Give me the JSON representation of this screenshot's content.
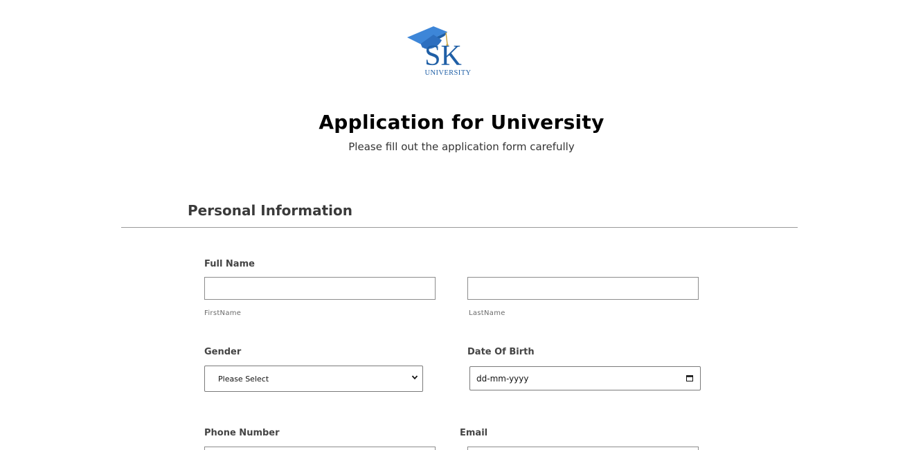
{
  "logo": {
    "mark": "SK",
    "subtext": "UNIVERSITY",
    "icon": "graduation-cap-icon"
  },
  "header": {
    "title": "Application for University",
    "subtitle": "Please fill out the application form carefully"
  },
  "section": {
    "title": "Personal Information"
  },
  "form": {
    "full_name": {
      "label": "Full Name",
      "first_value": "",
      "first_sublabel": "FirstName",
      "last_value": "",
      "last_sublabel": "LastName"
    },
    "gender": {
      "label": "Gender",
      "selected": "Please Select"
    },
    "dob": {
      "label": "Date Of Birth",
      "placeholder": "dd-mm-yyyy"
    },
    "phone": {
      "label": "Phone Number",
      "value": ""
    },
    "email": {
      "label": "Email",
      "value": ""
    }
  },
  "colors": {
    "logo_blue": "#1f5fa6",
    "cap_blue": "#3d86d8",
    "tassel_gold": "#c9a545",
    "border": "#8c8c8c",
    "divider": "#9a9a9a"
  }
}
